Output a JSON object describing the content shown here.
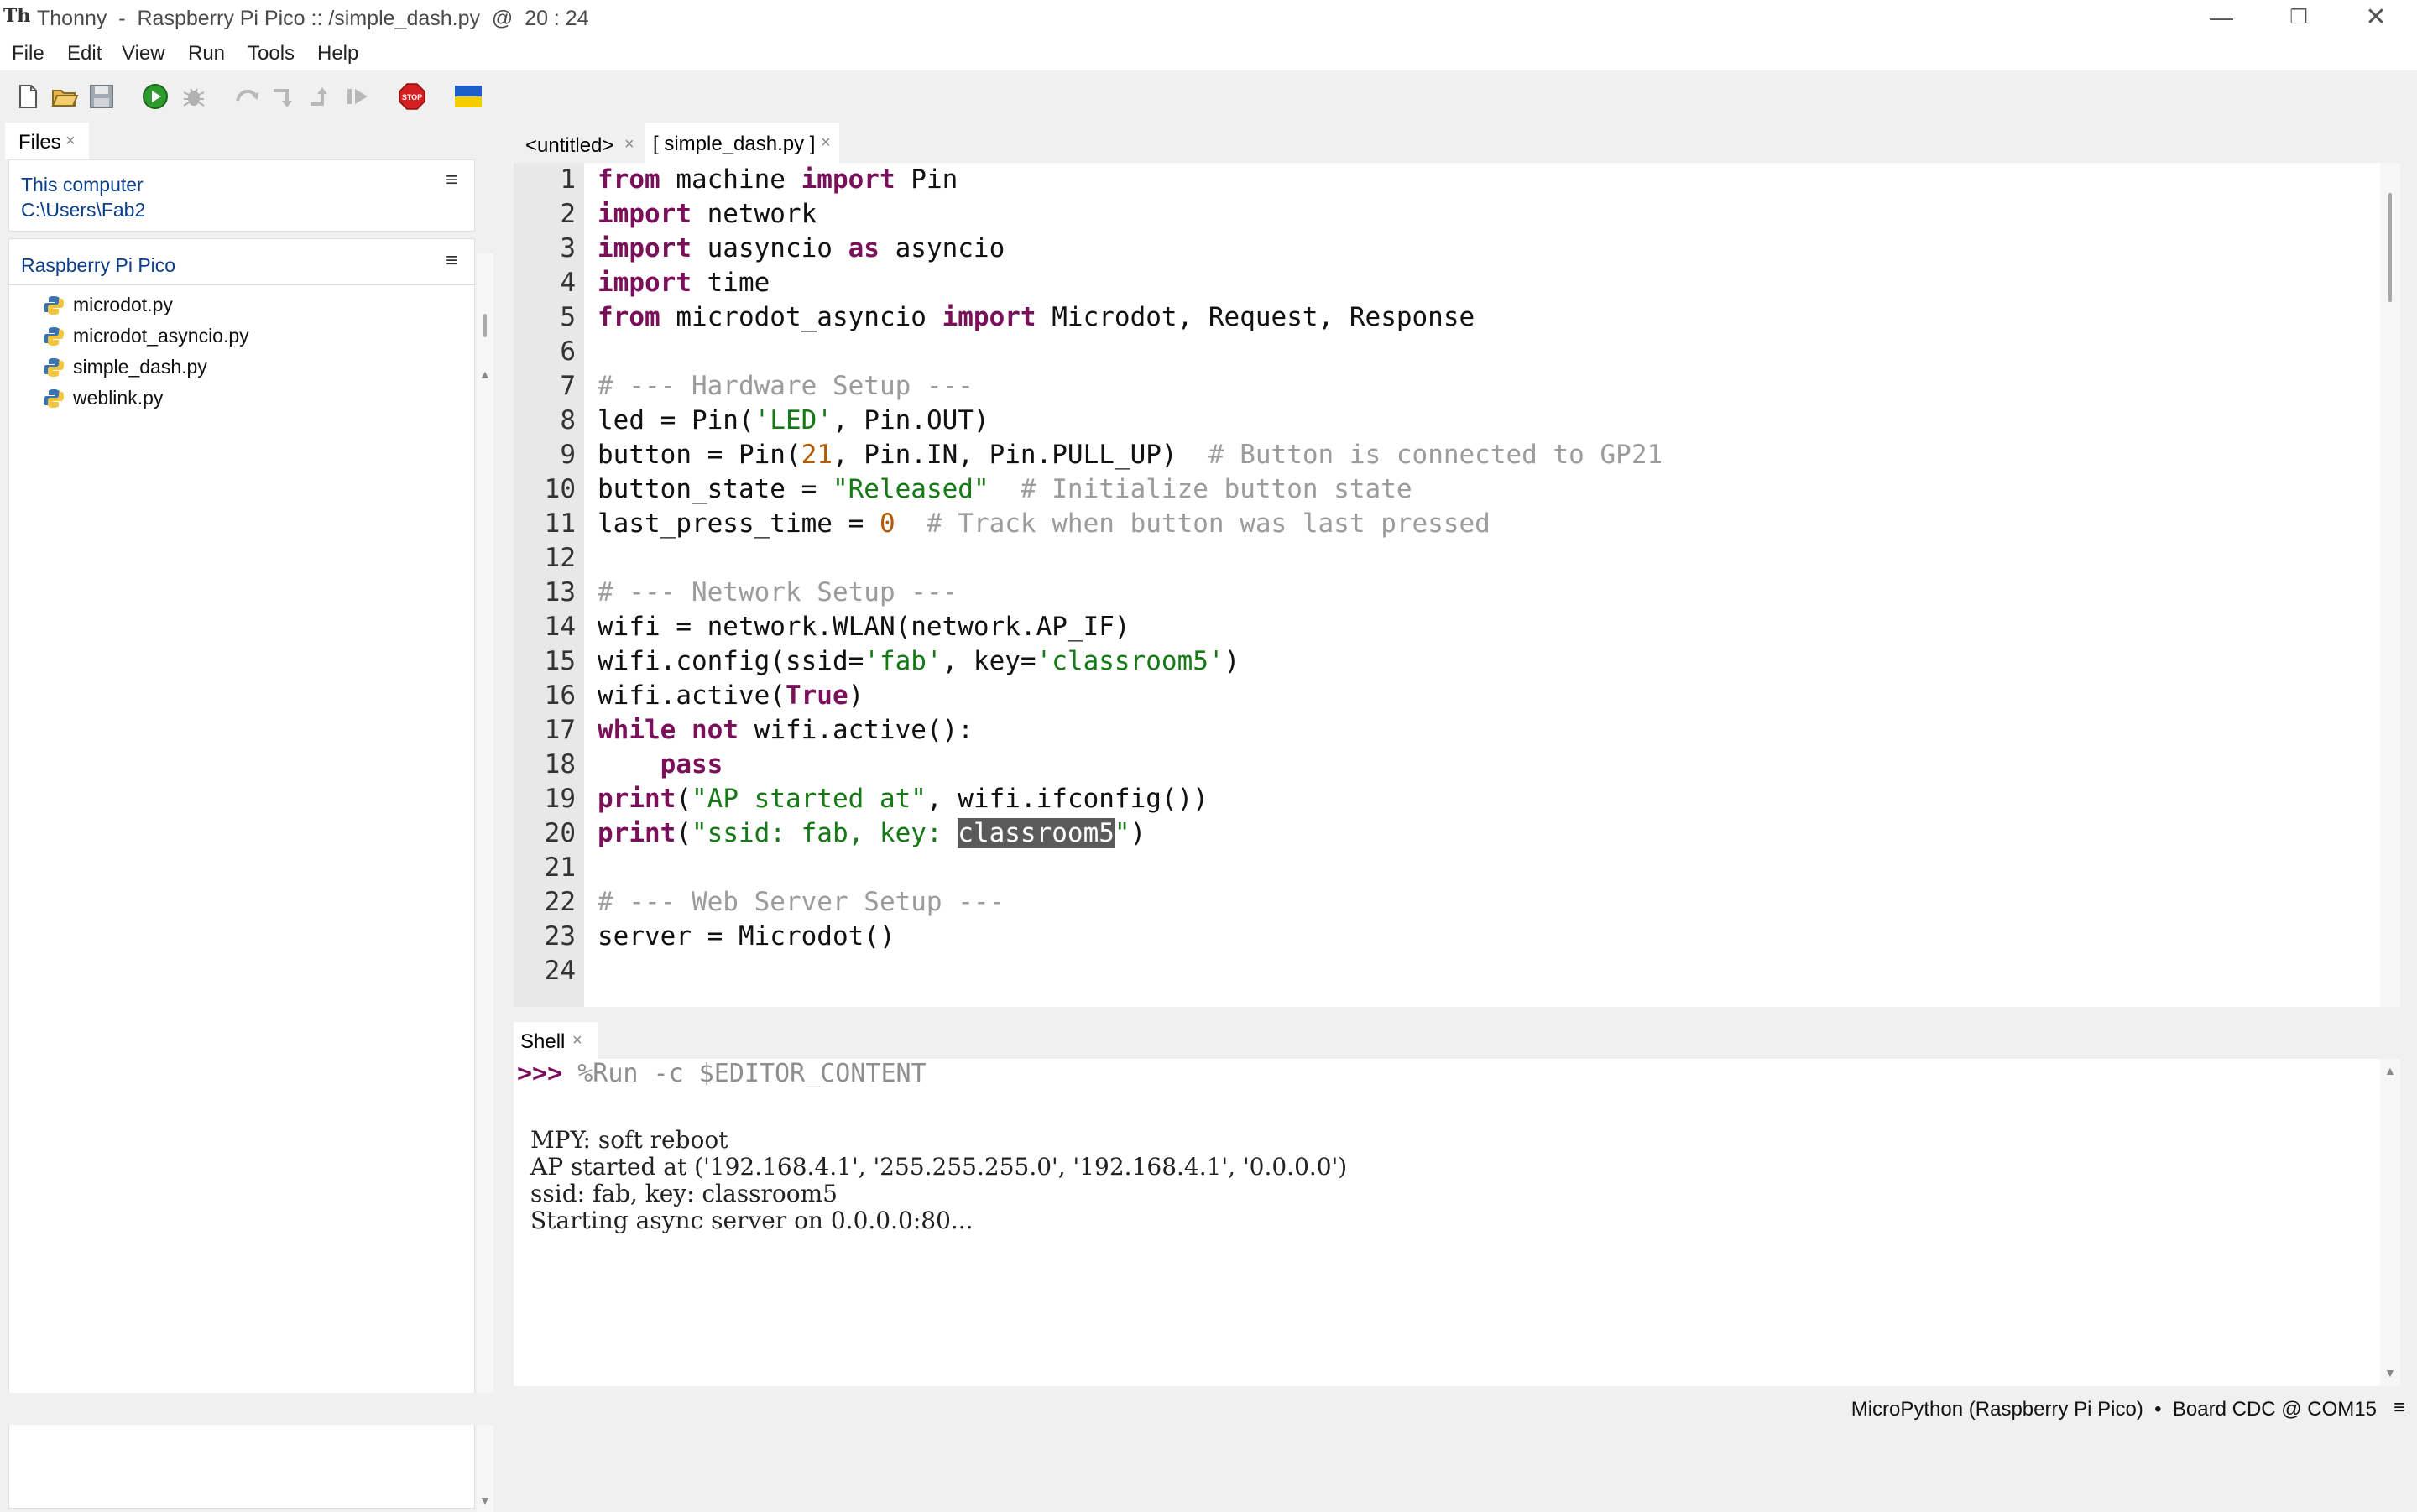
{
  "window": {
    "title": "Thonny  -  Raspberry Pi Pico :: /simple_dash.py  @  20 : 24",
    "app_icon": "thonny-icon"
  },
  "menu": [
    "File",
    "Edit",
    "View",
    "Run",
    "Tools",
    "Help"
  ],
  "toolbar": [
    "new-file-icon",
    "open-folder-icon",
    "save-icon",
    "run-icon",
    "debug-icon",
    "step-over-icon",
    "step-into-icon",
    "step-out-icon",
    "resume-icon",
    "stop-icon",
    "ukraine-flag-icon"
  ],
  "files_panel": {
    "tab_label": "Files",
    "this_computer": {
      "title": "This computer",
      "path": "C:\\Users\\Fab2"
    },
    "device": {
      "title": "Raspberry Pi Pico",
      "files": [
        "microdot.py",
        "microdot_asyncio.py",
        "simple_dash.py",
        "weblink.py"
      ]
    }
  },
  "editor": {
    "tabs": [
      {
        "label": "<untitled>",
        "active": false
      },
      {
        "label": "[ simple_dash.py ]",
        "active": true
      }
    ],
    "lines": [
      "from machine import Pin",
      "import network",
      "import uasyncio as asyncio",
      "import time",
      "from microdot_asyncio import Microdot, Request, Response",
      "",
      "# --- Hardware Setup ---",
      "led = Pin('LED', Pin.OUT)",
      "button = Pin(21, Pin.IN, Pin.PULL_UP)  # Button is connected to GP21",
      "button_state = \"Released\"  # Initialize button state",
      "last_press_time = 0  # Track when button was last pressed",
      "",
      "# --- Network Setup ---",
      "wifi = network.WLAN(network.AP_IF)",
      "wifi.config(ssid='fab', key='classroom5')",
      "wifi.active(True)",
      "while not wifi.active():",
      "    pass",
      "print(\"AP started at\", wifi.ifconfig())",
      "print(\"ssid: fab, key: classroom5\")",
      "",
      "# --- Web Server Setup ---",
      "server = Microdot()",
      ""
    ],
    "selected_text": "classroom5"
  },
  "shell": {
    "tab_label": "Shell",
    "prompt": ">>>",
    "command": "%Run -c $EDITOR_CONTENT",
    "output": [
      "MPY: soft reboot",
      "AP started at ('192.168.4.1', '255.255.255.0', '192.168.4.1', '0.0.0.0')",
      "ssid: fab, key: classroom5",
      "Starting async server on 0.0.0.0:80..."
    ]
  },
  "status_bar": {
    "interpreter": "MicroPython (Raspberry Pi Pico)  •  Board CDC @ COM15"
  },
  "colors": {
    "keyword": "#7a0f5a",
    "string": "#157a15",
    "number": "#b35a00",
    "comment": "#9c9c9c",
    "link_blue": "#0a3e8c"
  }
}
